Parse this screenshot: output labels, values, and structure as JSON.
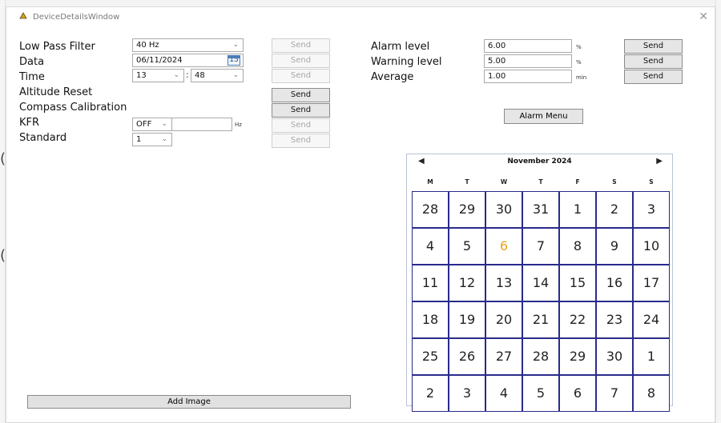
{
  "window": {
    "title": "DeviceDetailsWindow",
    "close_glyph": "✕"
  },
  "left": {
    "low_pass": {
      "label": "Low Pass Filter",
      "value": "40 Hz",
      "send": "Send"
    },
    "data": {
      "label": "Data",
      "value": "06/11/2024",
      "cal_icon": "15",
      "send": "Send"
    },
    "time": {
      "label": "Time",
      "hour": "13",
      "minute": "48",
      "separator": ":",
      "send": "Send"
    },
    "altitude_reset": {
      "label": "Altitude Reset",
      "send": "Send"
    },
    "compass_calibration": {
      "label": "Compass Calibration",
      "send": "Send"
    },
    "kfr": {
      "label": "KFR",
      "value": "OFF",
      "hz_value": "",
      "unit": "Hz",
      "send": "Send"
    },
    "standard": {
      "label": "Standard",
      "value": "1",
      "send": "Send"
    }
  },
  "right": {
    "alarm_level": {
      "label": "Alarm level",
      "value": "6.00",
      "unit": "%",
      "send": "Send"
    },
    "warning_level": {
      "label": "Warning level",
      "value": "5.00",
      "unit": "%",
      "send": "Send"
    },
    "average": {
      "label": "Average",
      "value": "1.00",
      "unit": "min",
      "send": "Send"
    },
    "alarm_menu": "Alarm Menu"
  },
  "add_image": "Add Image",
  "calendar": {
    "month": "November 2024",
    "prev_glyph": "◀",
    "next_glyph": "▶",
    "weekdays": [
      "M",
      "T",
      "W",
      "T",
      "F",
      "S",
      "S"
    ],
    "weeks": [
      [
        "28",
        "29",
        "30",
        "31",
        "1",
        "2",
        "3"
      ],
      [
        "4",
        "5",
        "6",
        "7",
        "8",
        "9",
        "10"
      ],
      [
        "11",
        "12",
        "13",
        "14",
        "15",
        "16",
        "17"
      ],
      [
        "18",
        "19",
        "20",
        "21",
        "22",
        "23",
        "24"
      ],
      [
        "25",
        "26",
        "27",
        "28",
        "29",
        "30",
        "1"
      ],
      [
        "2",
        "3",
        "4",
        "5",
        "6",
        "7",
        "8"
      ]
    ],
    "today": "6",
    "today_color": "#e8a21a",
    "border_color": "#2a2a8c"
  },
  "background": {
    "left_marks": [
      "(",
      "("
    ]
  }
}
